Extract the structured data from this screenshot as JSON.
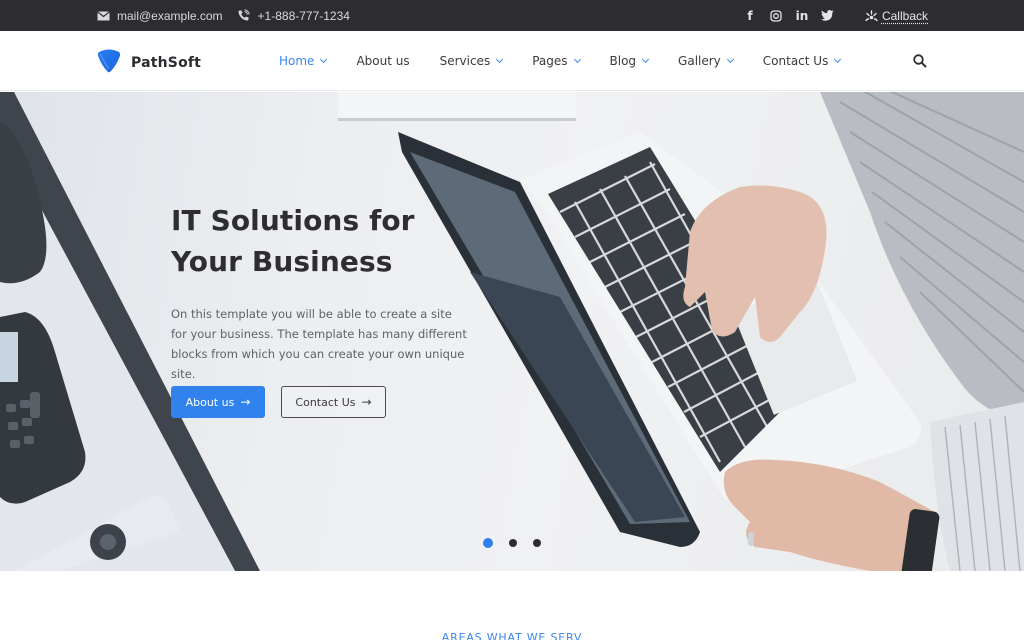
{
  "topbar": {
    "email": "mail@example.com",
    "phone": "+1-888-777-1234",
    "social": [
      {
        "name": "facebook",
        "glyph": "f"
      },
      {
        "name": "instagram",
        "glyph": "◎"
      },
      {
        "name": "linkedin",
        "glyph": "in"
      },
      {
        "name": "twitter",
        "glyph": "🐦"
      }
    ],
    "callback_label": "Callback"
  },
  "header": {
    "brand": "PathSoft",
    "nav": [
      {
        "label": "Home",
        "dropdown": true,
        "active": true
      },
      {
        "label": "About us",
        "dropdown": false,
        "active": false
      },
      {
        "label": "Services",
        "dropdown": true,
        "active": false
      },
      {
        "label": "Pages",
        "dropdown": true,
        "active": false
      },
      {
        "label": "Blog",
        "dropdown": true,
        "active": false
      },
      {
        "label": "Gallery",
        "dropdown": true,
        "active": false
      },
      {
        "label": "Contact Us",
        "dropdown": true,
        "active": false
      }
    ]
  },
  "hero": {
    "title_line1": "IT Solutions for",
    "title_line2": "Your Business",
    "description": "On this template you will be able to create a site for your business. The template has many different blocks from which you can create your own unique site.",
    "primary_button": "About us",
    "secondary_button": "Contact Us",
    "arrow": "→",
    "slides_total": 3,
    "active_slide": 1
  },
  "section": {
    "kicker": "AREAS WHAT WE SERV"
  },
  "colors": {
    "accent": "#3182ec",
    "topbar_bg": "#2c2c31",
    "heading": "#2d2d32"
  }
}
